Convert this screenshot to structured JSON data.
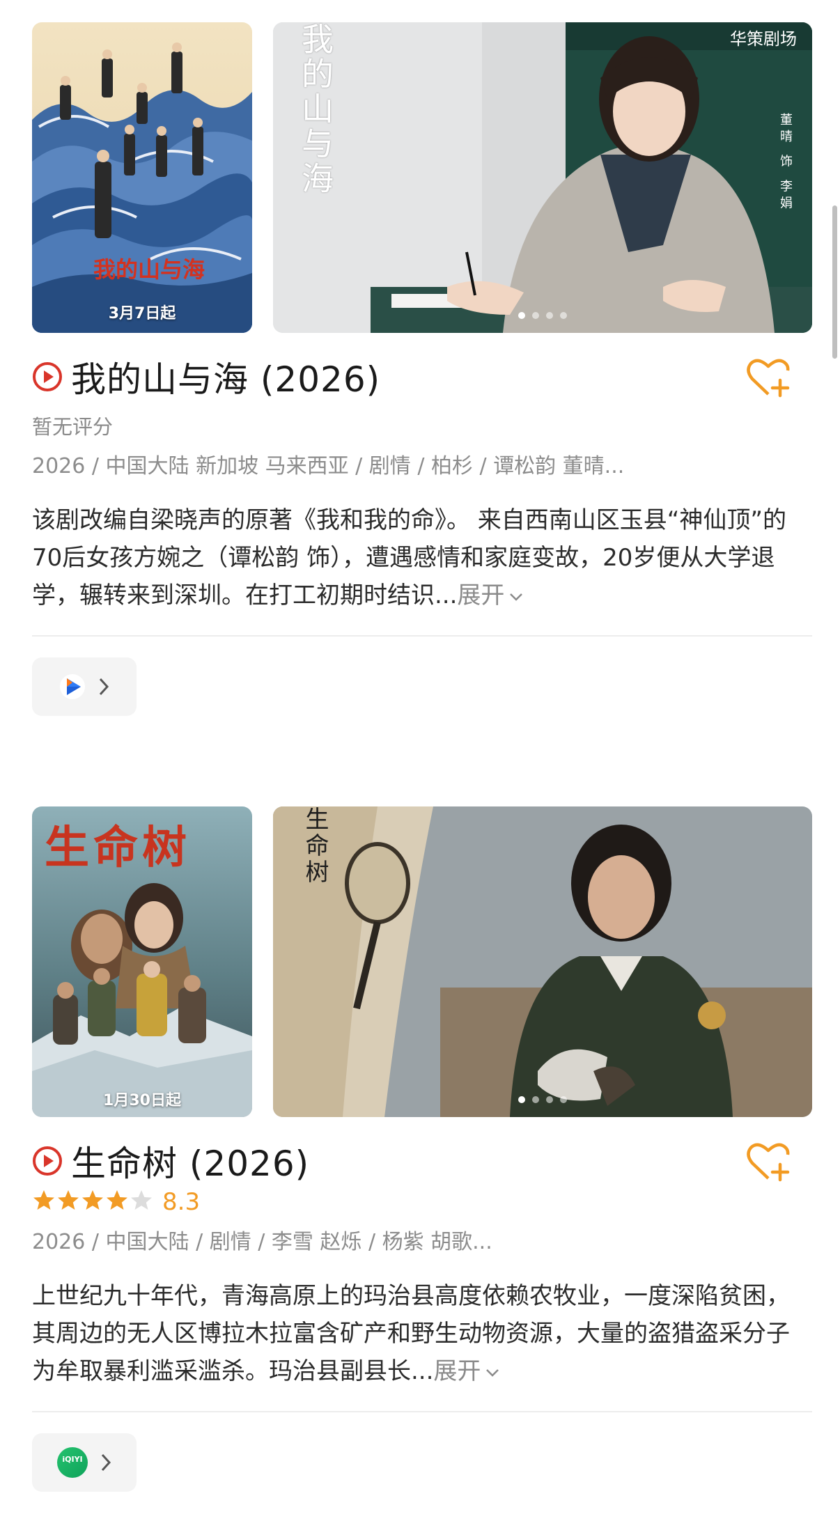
{
  "shows": [
    {
      "title": "我的山与海 (2026)",
      "rating_text": "暂无评分",
      "meta": "2026 / 中国大陆 新加坡 马来西亚 / 剧情 / 柏杉 / 谭松韵 董晴...",
      "description": "该剧改编自梁晓声的原著《我和我的命》。 来自西南山区玉县“神仙顶”的70后女孩方婉之（谭松韵 饰），遭遇感情和家庭变故，20岁便从大学退学，辗转来到深圳。在打工初期时结识...",
      "expand_label": "展开",
      "poster_date": "3月7日起",
      "poster_title": "我的山与海",
      "still_title": "我的山与海",
      "still_logo": "华策剧场",
      "still_caption": "董晴 饰 李娟",
      "source_icon": "play-triangle-app-icon",
      "carousel_dots": 4
    },
    {
      "title": "生命树 (2026)",
      "rating_stars": 4,
      "score": "8.3",
      "meta": "2026 / 中国大陆 / 剧情 / 李雪 赵烁 / 杨紫 胡歌...",
      "description": "上世纪九十年代，青海高原上的玛治县高度依赖农牧业，一度深陷贫困，其周边的无人区博拉木拉富含矿产和野生动物资源，大量的盗猎盗采分子为牟取暴利滥采滥杀。玛治县副县长...",
      "expand_label": "展开",
      "poster_date": "1月30日起",
      "poster_title": "生命树",
      "still_title": "生命树",
      "source_label": "iQIYI 爱奇艺",
      "carousel_dots": 4
    }
  ],
  "colors": {
    "accent_red": "#d9352a",
    "accent_orange": "#f29b24"
  }
}
